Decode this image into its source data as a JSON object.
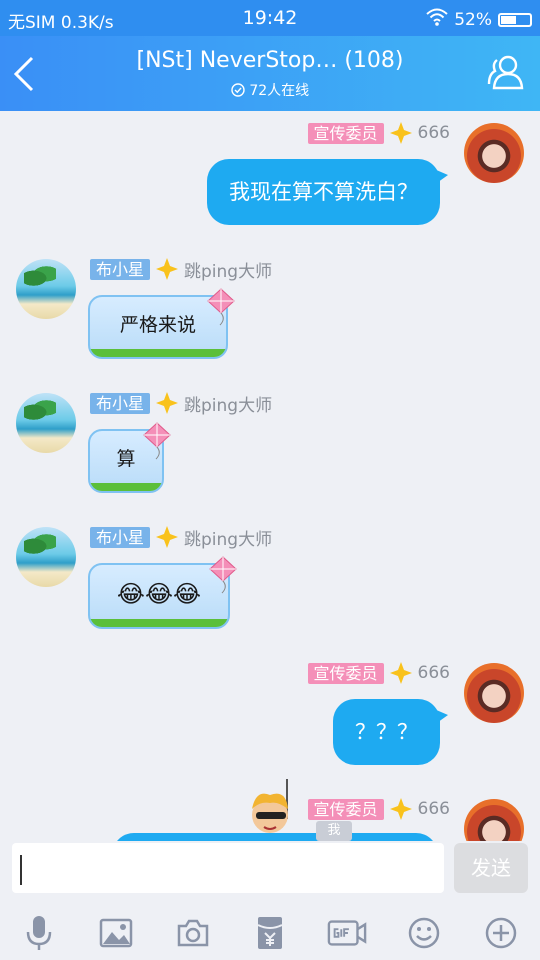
{
  "status_bar": {
    "carrier": "无SIM 0.3K/s",
    "time": "19:42",
    "battery": "52%",
    "battery_level": 0.52
  },
  "header": {
    "title": "[NSt] NeverStop… (108)",
    "online": "72人在线"
  },
  "messages": [
    {
      "sender": "me",
      "tag": "宣传委员",
      "level": "666",
      "text": "我现在算不算洗白？"
    },
    {
      "sender": "other",
      "tag": "布小星",
      "level": "跳ping大师",
      "text": "严格来说"
    },
    {
      "sender": "other",
      "tag": "布小星",
      "level": "跳ping大师",
      "text": "算"
    },
    {
      "sender": "other",
      "tag": "布小星",
      "level": "跳ping大师",
      "text": "😂😂😂"
    },
    {
      "sender": "me",
      "tag": "宣传委员",
      "level": "666",
      "text": "？？？"
    },
    {
      "sender": "me",
      "tag": "宣传委员",
      "level": "666",
      "text": ""
    }
  ],
  "peek_label": "我",
  "input": {
    "placeholder": ""
  },
  "send_label": "发送",
  "toolbar": [
    "microphone-icon",
    "image-icon",
    "camera-icon",
    "red-packet-icon",
    "gif-icon",
    "emoji-icon",
    "plus-icon"
  ]
}
